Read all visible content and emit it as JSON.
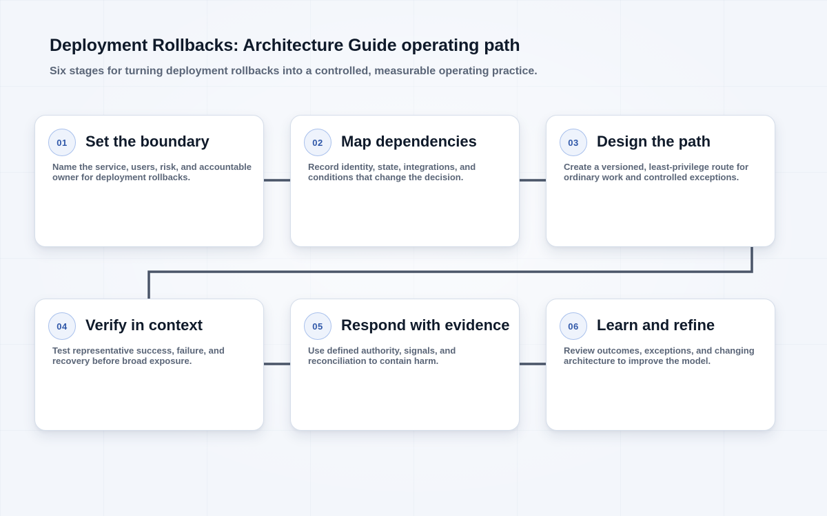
{
  "header": {
    "title": "Deployment Rollbacks: Architecture Guide operating path",
    "subtitle": "Six stages for turning deployment rollbacks into a controlled, measurable operating practice."
  },
  "colors": {
    "connector": "#4a5568",
    "badge_text": "#2f57a8",
    "badge_border": "#a8c0ec",
    "card_bg": "#ffffff"
  },
  "stages": [
    {
      "number": "01",
      "title": "Set the boundary",
      "description": "Name the service, users, risk, and accountable owner for deployment rollbacks."
    },
    {
      "number": "02",
      "title": "Map dependencies",
      "description": "Record identity, state, integrations, and conditions that change the decision."
    },
    {
      "number": "03",
      "title": "Design the path",
      "description": "Create a versioned, least-privilege route for ordinary work and controlled exceptions."
    },
    {
      "number": "04",
      "title": "Verify in context",
      "description": "Test representative success, failure, and recovery before broad exposure."
    },
    {
      "number": "05",
      "title": "Respond with evidence",
      "description": "Use defined authority, signals, and reconciliation to contain harm."
    },
    {
      "number": "06",
      "title": "Learn and refine",
      "description": "Review outcomes, exceptions, and changing architecture to improve the model."
    }
  ]
}
